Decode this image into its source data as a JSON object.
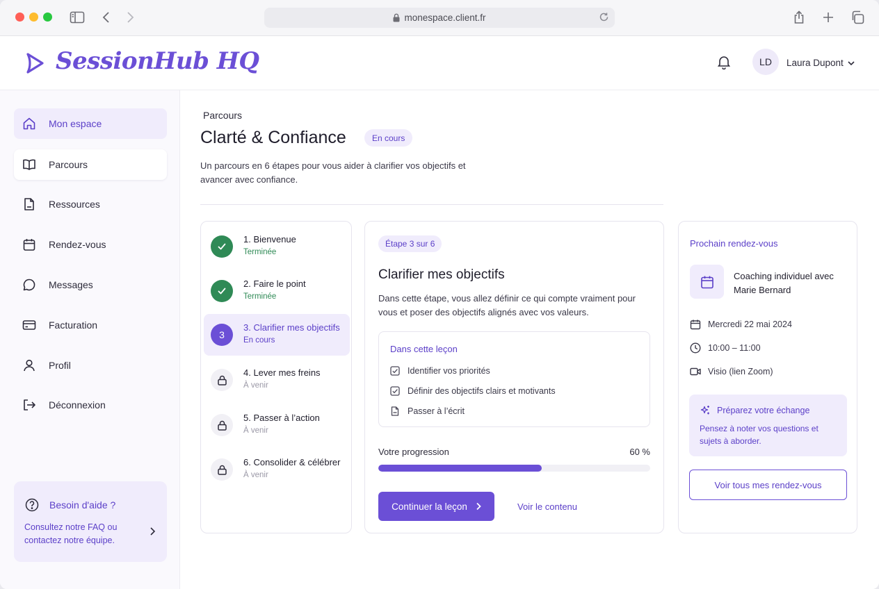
{
  "browser": {
    "url": "monespace.client.fr"
  },
  "header": {
    "brand": "SessionHub HQ",
    "user": {
      "initials": "LD",
      "name": "Laura Dupont"
    }
  },
  "sidebar": {
    "items": [
      {
        "label": "Mon espace",
        "icon": "home-icon"
      },
      {
        "label": "Parcours",
        "icon": "book-icon"
      },
      {
        "label": "Ressources",
        "icon": "document-icon"
      },
      {
        "label": "Rendez-vous",
        "icon": "calendar-icon"
      },
      {
        "label": "Messages",
        "icon": "message-icon"
      },
      {
        "label": "Facturation",
        "icon": "credit-card-icon"
      },
      {
        "label": "Profil",
        "icon": "user-icon"
      },
      {
        "label": "Déconnexion",
        "icon": "logout-icon"
      }
    ],
    "help": {
      "title": "Besoin d'aide ?",
      "text": "Consultez notre FAQ ou contactez notre équipe."
    }
  },
  "main": {
    "breadcrumb": "Parcours",
    "title": "Clarté & Confiance",
    "status": "En cours",
    "description": "Un parcours en 6 étapes pour vous aider à clarifier vos objectifs et avancer avec confiance."
  },
  "steps": [
    {
      "badge": "",
      "title": "1. Bienvenue",
      "status": "Terminée",
      "state": "done"
    },
    {
      "badge": "",
      "title": "2. Faire le point",
      "status": "Terminée",
      "state": "done"
    },
    {
      "badge": "3",
      "title": "3. Clarifier mes objectifs",
      "status": "En cours",
      "state": "current"
    },
    {
      "badge": "",
      "title": "4. Lever mes freins",
      "status": "À venir",
      "state": "locked"
    },
    {
      "badge": "",
      "title": "5. Passer à l’action",
      "status": "À venir",
      "state": "locked"
    },
    {
      "badge": "",
      "title": "6. Consolider & célébrer",
      "status": "À venir",
      "state": "locked"
    }
  ],
  "lesson": {
    "stage": "Étape 3 sur 6",
    "title": "Clarifier mes objectifs",
    "description": "Dans cette étape, vous allez définir ce qui compte vraiment pour vous et poser des objectifs alignés avec vos valeurs.",
    "box_title": "Dans cette leçon",
    "items": [
      {
        "label": "Identifier vos priorités",
        "icon": "checkbox-icon"
      },
      {
        "label": "Définir des objectifs clairs et motivants",
        "icon": "checkbox-icon"
      },
      {
        "label": "Passer à l’écrit",
        "icon": "file-icon"
      }
    ],
    "progress_label": "Votre progression",
    "progress_text": "60 %",
    "progress": 0.6,
    "primary_button": "Continuer la leçon",
    "secondary_link": "Voir le contenu"
  },
  "appointment": {
    "heading": "Prochain rendez-vous",
    "title": "Coaching individuel avec Marie Bernard",
    "date": "Mercredi 22 mai 2024",
    "time": "10:00 – 11:00",
    "location": "Visio (lien Zoom)",
    "prep_title": "Préparez votre échange",
    "prep_text": "Pensez à noter vos questions et sujets à aborder.",
    "button": "Voir tous mes rendez-vous"
  },
  "colors": {
    "accent": "#6b4fd6",
    "accent_soft": "#f0ecfc",
    "success": "#2f8a56"
  }
}
